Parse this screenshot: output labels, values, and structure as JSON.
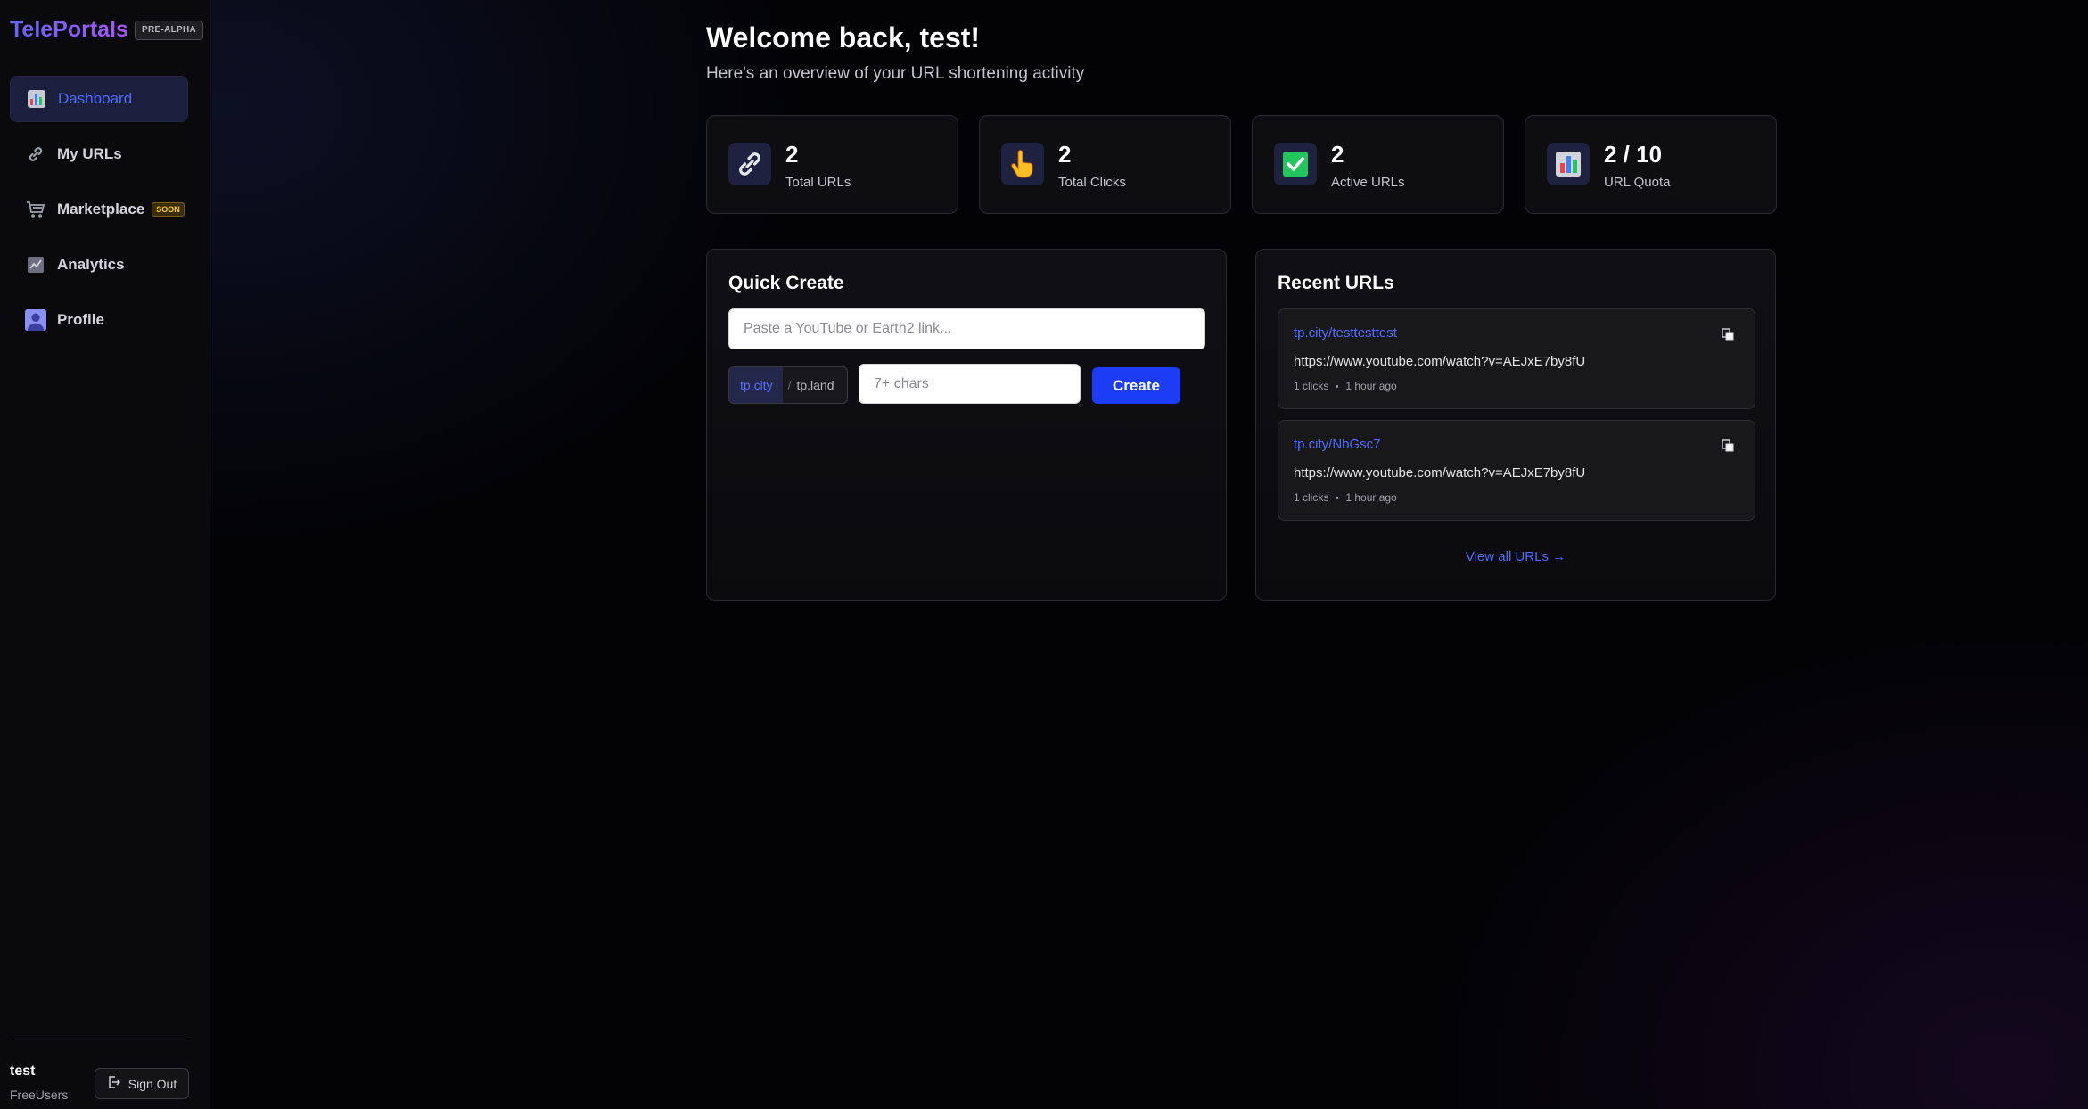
{
  "sidebar": {
    "brand": "TelePortals",
    "badge": "PRE-ALPHA",
    "items": [
      {
        "label": "Dashboard",
        "icon": "bar-chart-icon",
        "active": true
      },
      {
        "label": "My URLs",
        "icon": "link-icon"
      },
      {
        "label": "Marketplace",
        "icon": "shopping-cart-icon",
        "badge": "SOON"
      },
      {
        "label": "Analytics",
        "icon": "line-chart-icon"
      },
      {
        "label": "Profile",
        "icon": "user-icon"
      }
    ],
    "user": {
      "name": "test",
      "plan": "FreeUsers"
    },
    "sign_out": "Sign Out"
  },
  "header": {
    "title": "Welcome back, test!",
    "subtitle": "Here's an overview of your URL shortening activity"
  },
  "stats": [
    {
      "value": "2",
      "label": "Total URLs",
      "icon": "link-icon"
    },
    {
      "value": "2",
      "label": "Total Clicks",
      "icon": "pointing-hand-icon"
    },
    {
      "value": "2",
      "label": "Active URLs",
      "icon": "check-mark-icon"
    },
    {
      "value": "2 / 10",
      "label": "URL Quota",
      "icon": "bar-chart-icon"
    }
  ],
  "quick_create": {
    "title": "Quick Create",
    "link_placeholder": "Paste a YouTube or Earth2 link...",
    "domains": [
      "tp.city",
      "tp.land"
    ],
    "domain_separator": "/",
    "slug_placeholder": "7+ chars",
    "create_label": "Create"
  },
  "recent": {
    "title": "Recent URLs",
    "items": [
      {
        "short": "tp.city/testtesttest",
        "long": "https://www.youtube.com/watch?v=AEJxE7by8fU",
        "clicks": "1 clicks",
        "time": "1 hour ago"
      },
      {
        "short": "tp.city/NbGsc7",
        "long": "https://www.youtube.com/watch?v=AEJxE7by8fU",
        "clicks": "1 clicks",
        "time": "1 hour ago"
      }
    ],
    "view_all": "View all URLs →"
  },
  "colors": {
    "accent": "#4f6bff",
    "button": "#1d3cf5",
    "soon": "#facc15"
  }
}
